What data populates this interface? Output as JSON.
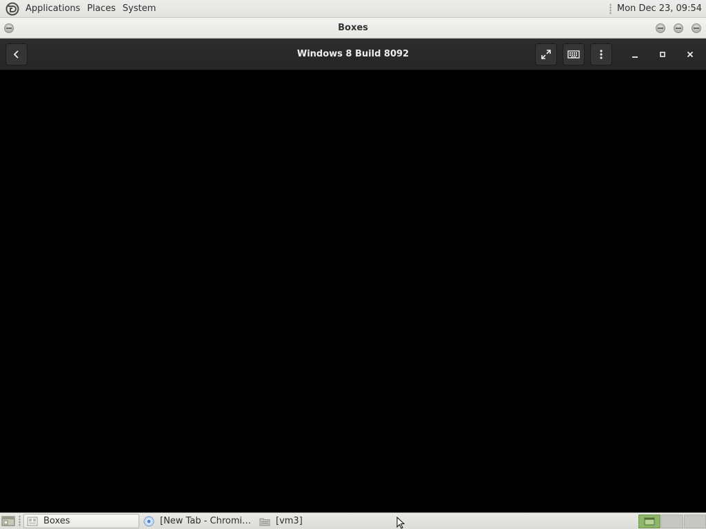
{
  "top_panel": {
    "menus": [
      "Applications",
      "Places",
      "System"
    ],
    "clock": "Mon Dec 23, 09:54"
  },
  "window": {
    "title": "Boxes"
  },
  "header_bar": {
    "title": "Windows 8 Build 8092"
  },
  "taskbar": {
    "tasks": [
      {
        "label": "Boxes",
        "icon": "boxes-app-icon",
        "active": true
      },
      {
        "label": "[New Tab - Chromi…",
        "icon": "chromium-icon",
        "active": false
      },
      {
        "label": "[vm3]",
        "icon": "folder-icon",
        "active": false
      }
    ],
    "workspaces": [
      {
        "active": true
      },
      {
        "active": false
      },
      {
        "active": false
      }
    ]
  },
  "colors": {
    "header_bg": "#2d2d2d",
    "vm_display_bg": "#000000",
    "panel_bg": "#ededeb",
    "workspace_active": "#8fb56a"
  }
}
